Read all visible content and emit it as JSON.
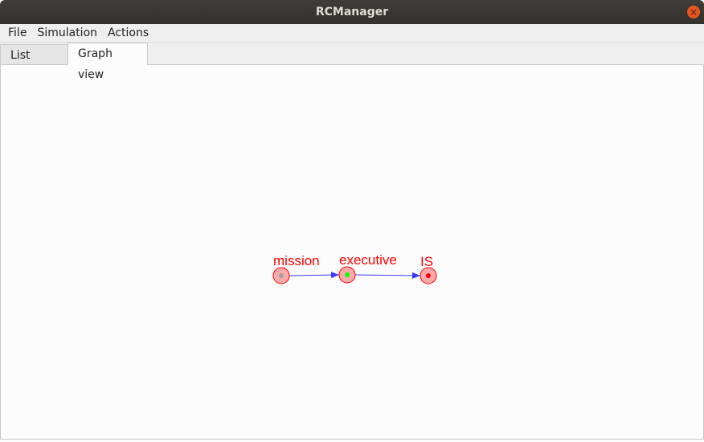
{
  "window": {
    "title": "RCManager",
    "close_icon": "close-icon"
  },
  "menu": [
    "File",
    "Simulation",
    "Actions"
  ],
  "tabs": [
    {
      "label": "List view",
      "active": false
    },
    {
      "label": "Graph view",
      "active": true
    }
  ],
  "graph": {
    "nodes": [
      {
        "label": "mission",
        "status_color": "#a0a0a0"
      },
      {
        "label": "executive",
        "status_color": "#00ff00"
      },
      {
        "label": "IS",
        "status_color": "#ff0000"
      }
    ],
    "edges": [
      {
        "from": "mission",
        "to": "executive"
      },
      {
        "from": "executive",
        "to": "IS"
      }
    ],
    "edge_color": "#3a3aff",
    "node_fill": "#ffaaaa",
    "node_stroke": "#ff0000"
  }
}
